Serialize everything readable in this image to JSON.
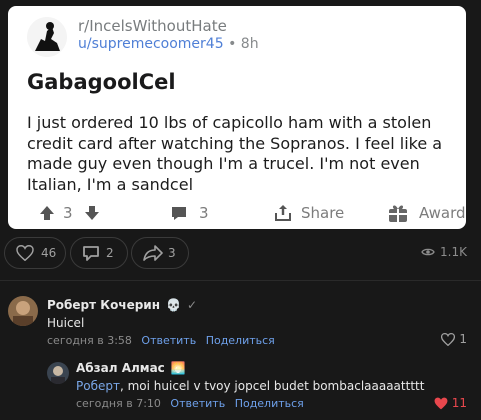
{
  "post": {
    "subreddit": "r/IncelsWithoutHate",
    "username": "u/supremecoomer45",
    "time": "8h",
    "title": "GabagoolCel",
    "body": "I just ordered 10 lbs of capicollo ham with a stolen credit card after watching the Sopranos. I feel like a made guy even though I'm a trucel. I'm not even Italian, I'm a sandcel",
    "votes": "3",
    "comments": "3",
    "share_label": "Share",
    "award_label": "Award"
  },
  "stats": {
    "likes": "46",
    "comments": "2",
    "shares": "3",
    "views": "1.1K"
  },
  "comments": [
    {
      "author": "Роберт Кочерин",
      "badge": "💀",
      "text": "Huicel",
      "time": "сегодня в 3:58",
      "reply_label": "Ответить",
      "share_label": "Поделиться",
      "likes": "1"
    },
    {
      "author": "Абзал Алмас",
      "badge": "🌅",
      "mention": "Роберт",
      "text": ", moi huicel v tvoy jopcel budet bombaclaaaaattttt",
      "time": "сегодня в 7:10",
      "reply_label": "Ответить",
      "share_label": "Поделиться",
      "likes": "11"
    }
  ],
  "colors": {
    "accent_link": "#6ea0ea",
    "liked_heart": "#e8474d",
    "background": "#181818"
  }
}
